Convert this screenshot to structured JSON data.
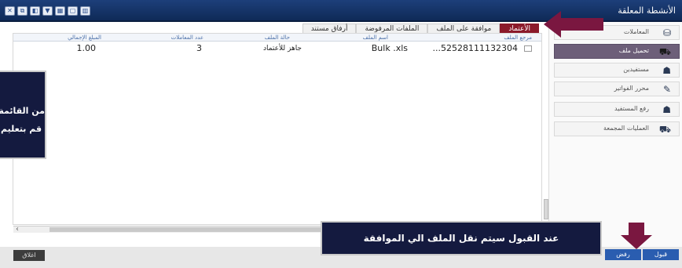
{
  "window": {
    "title": "الأنشطة المعلقة",
    "buttons": [
      "✕",
      "⧉",
      "◧",
      "▼",
      "▦",
      "▢",
      "▥"
    ]
  },
  "tabs": [
    {
      "label": "الأعتماد",
      "active": true
    },
    {
      "label": "موافقة على الملف",
      "active": false
    },
    {
      "label": "الملفات المرفوضة",
      "active": false
    },
    {
      "label": "أرفاق مستند",
      "active": false
    }
  ],
  "grid": {
    "headers": {
      "file_ref": "مرجع الملف",
      "file_name": "اسم الملف",
      "file_status": "حالة الملف",
      "tx_count": "عدد المعاملات",
      "total_amount": "المبلغ الإجمالي"
    },
    "rows": [
      {
        "file_ref": "...52528111132304",
        "file_name": "Bulk .xls",
        "file_status": "جاهز للأعتماد",
        "tx_count": "3",
        "total_amount": "1.00"
      }
    ]
  },
  "sidebar": {
    "items": [
      {
        "label": "المعاملات",
        "icon": "bank-icon",
        "glyph": "⛁",
        "active": false
      },
      {
        "label": "تحميل ملف",
        "icon": "truck-icon",
        "glyph": "⛟",
        "active": true
      },
      {
        "label": "مستفيدين",
        "icon": "users-icon",
        "glyph": "☗",
        "active": false
      },
      {
        "label": "محرر الفواتير",
        "icon": "invoice-icon",
        "glyph": "✎",
        "active": false
      },
      {
        "label": "رفع المستفيد",
        "icon": "add-user-icon",
        "glyph": "☗",
        "active": false
      },
      {
        "label": "العمليات المجمعة",
        "icon": "bulk-icon",
        "glyph": "⛟",
        "active": false
      }
    ]
  },
  "buttons": {
    "accept": "قبول",
    "reject": "رفض",
    "close": "اغلاق"
  },
  "annotations": {
    "left_line1": "من القائمة",
    "left_line2": "قم بتعليم",
    "bottom": "عند القبول سيتم نقل الملف الي الموافقة"
  },
  "colors": {
    "title_bar": "#1d3f7a",
    "active_tab": "#8b1a2b",
    "active_sidebar": "#6d5f79",
    "action_buttons": "#2a5db0",
    "annotation_bg": "#141a3f",
    "arrow": "#7a1740"
  }
}
